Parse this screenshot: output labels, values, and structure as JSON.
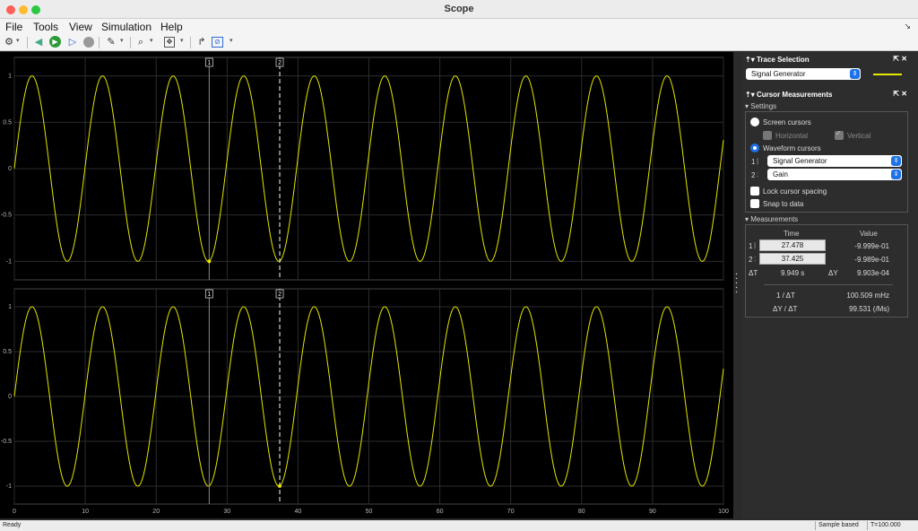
{
  "window": {
    "title": "Scope"
  },
  "menu": [
    "File",
    "Tools",
    "View",
    "Simulation",
    "Help"
  ],
  "toolbar": {
    "icons": [
      "gear-icon",
      "step-back-icon",
      "run-icon",
      "step-forward-icon",
      "stop-icon",
      "highlight-icon",
      "zoom-icon",
      "autoscale-icon",
      "triggers-icon",
      "measurements-icon"
    ]
  },
  "plots": {
    "y_ticks": [
      "1",
      "0.5",
      "0",
      "-0.5",
      "-1"
    ],
    "x_ticks": [
      "0",
      "10",
      "20",
      "30",
      "40",
      "50",
      "60",
      "70",
      "80",
      "90",
      "100"
    ],
    "cursor_labels": [
      "1",
      "2"
    ],
    "trace_color": "#e6e600",
    "background": "#000000"
  },
  "chart_data": [
    {
      "type": "line",
      "series": [
        {
          "values_desc": "sin",
          "color": "#e6e600"
        }
      ],
      "function": "sin",
      "frequency_hz": 0.1005,
      "amplitude": 1,
      "xlim": [
        0,
        100
      ],
      "ylim": [
        -1.2,
        1.2
      ],
      "x_ticks": [
        0,
        10,
        20,
        30,
        40,
        50,
        60,
        70,
        80,
        90,
        100
      ],
      "y_ticks": [
        1,
        0.5,
        0,
        -0.5,
        -1
      ],
      "cursors": [
        27.478,
        37.425
      ],
      "cursor_markers": [
        {
          "cursor": 1,
          "x": 27.478,
          "y": -0.9999
        }
      ],
      "grid": true
    },
    {
      "type": "line",
      "series": [
        {
          "values_desc": "sin",
          "color": "#e6e600"
        }
      ],
      "function": "sin",
      "frequency_hz": 0.1005,
      "amplitude": 1,
      "xlim": [
        0,
        100
      ],
      "ylim": [
        -1.2,
        1.2
      ],
      "x_ticks": [
        0,
        10,
        20,
        30,
        40,
        50,
        60,
        70,
        80,
        90,
        100
      ],
      "y_ticks": [
        1,
        0.5,
        0,
        -0.5,
        -1
      ],
      "cursors": [
        27.478,
        37.425
      ],
      "cursor_markers": [
        {
          "cursor": 2,
          "x": 37.425,
          "y": -0.9989
        }
      ],
      "grid": true
    }
  ],
  "trace_selection": {
    "title": "Trace Selection",
    "selected": "Signal Generator"
  },
  "cursor_measurements": {
    "title": "Cursor Measurements",
    "settings_label": "Settings",
    "screen_cursors": "Screen cursors",
    "horizontal": "Horizontal",
    "vertical": "Vertical",
    "waveform_cursors": "Waveform cursors",
    "cursor1_num": "1",
    "cursor2_num": "2",
    "cursor1_signal": "Signal Generator",
    "cursor2_signal": "Gain",
    "lock_spacing": "Lock cursor spacing",
    "snap_to_data": "Snap to data",
    "measurements_label": "Measurements",
    "col_time": "Time",
    "col_value": "Value",
    "row1_time": "27.478",
    "row1_value": "-9.999e-01",
    "row2_time": "37.425",
    "row2_value": "-9.989e-01",
    "delta_t_label": "ΔT",
    "delta_t": "9.949 s",
    "delta_y_label": "ΔY",
    "delta_y": "9.903e-04",
    "inv_dt_label": "1 / ΔT",
    "inv_dt": "100.509 mHz",
    "dy_dt_label": "ΔY / ΔT",
    "dy_dt": "99.531 (/Ms)"
  },
  "status": {
    "left": "Ready",
    "mode": "Sample based",
    "time": "T=100.000"
  }
}
